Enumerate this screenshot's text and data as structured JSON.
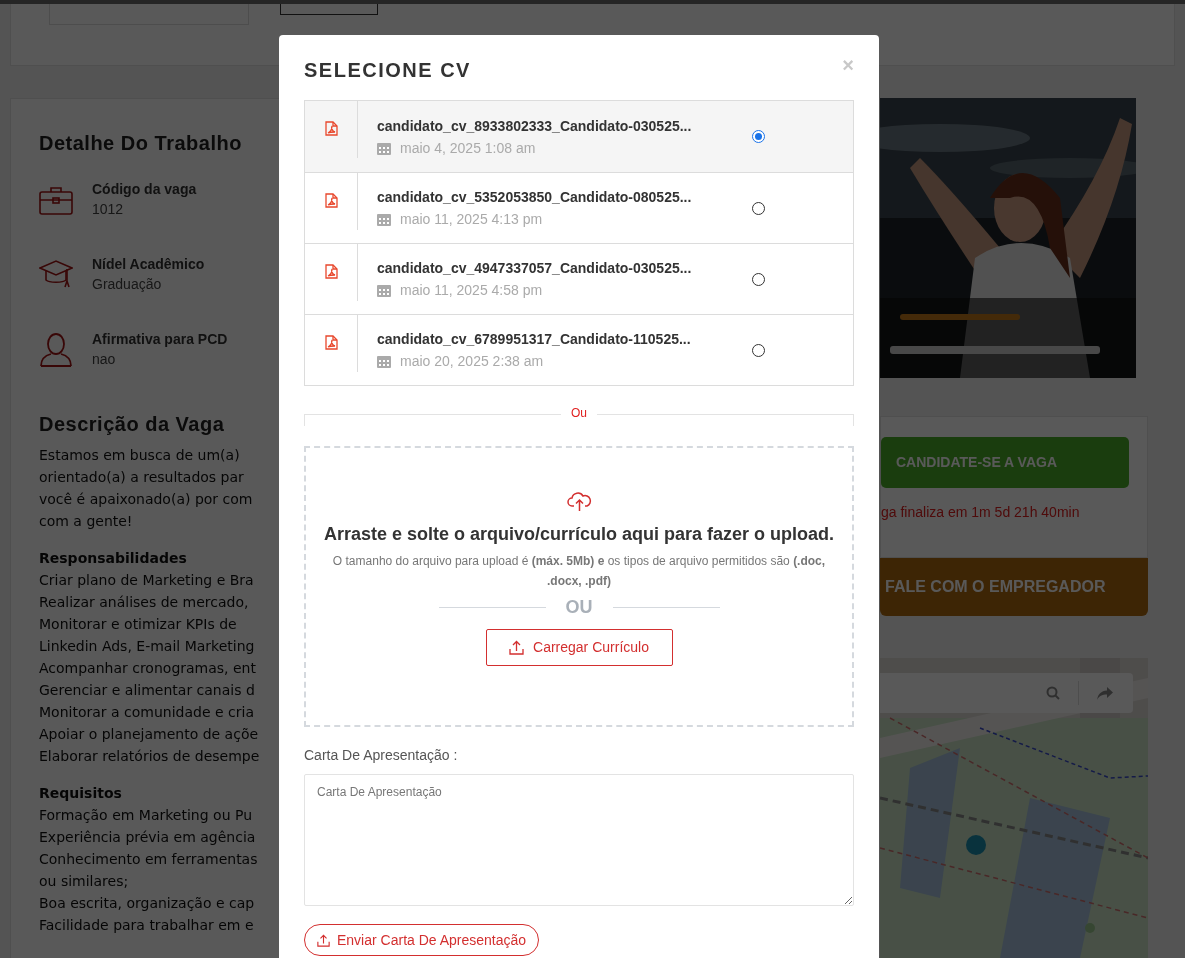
{
  "job_details": {
    "heading": "Detalhe Do Trabalho",
    "items": [
      {
        "kind": "briefcase",
        "label": "Código da vaga",
        "value": "1012"
      },
      {
        "kind": "cap",
        "label": "Nídel Acadêmico",
        "value": "Graduação"
      },
      {
        "kind": "person",
        "label": "Afirmativa para PCD",
        "value": "nao"
      }
    ]
  },
  "description": {
    "heading": "Descrição da Vaga",
    "sections": [
      {
        "lines": [
          "Estamos em busca de um(a)",
          "orientado(a) a resultados par",
          "você é apaixonado(a) por com",
          "com a gente!"
        ]
      },
      {
        "title": "Responsabilidades",
        "lines": [
          "Criar plano de Marketing e Bra",
          "Realizar análises de mercado,",
          "Monitorar e otimizar KPIs de",
          "Linkedin Ads, E-mail Marketing",
          "Acompanhar cronogramas, ent",
          "Gerenciar e alimentar canais d",
          "Monitorar a comunidade e cria",
          "Apoiar o planejamento de açõe",
          "Elaborar relatórios de desempe"
        ]
      },
      {
        "title": "Requisitos",
        "lines": [
          "Formação em Marketing ou Pu",
          "Experiência prévia em agência",
          "Conhecimento em ferramentas",
          "ou similares;",
          "Boa escrita, organização e cap",
          "Facilidade para trabalhar em e"
        ]
      }
    ]
  },
  "sidebar": {
    "apply_button": "CANDIDATE-SE A VAGA",
    "deadline": "ga finaliza em 1m 5d 21h 40min",
    "contact_button": "FALE COM O EMPREGADOR"
  },
  "modal": {
    "title": "SELECIONE CV",
    "close": "×",
    "cvs": [
      {
        "name": "candidato_cv_8933802333_Candidato-030525...",
        "date": "maio 4, 2025 1:08 am",
        "selected": true
      },
      {
        "name": "candidato_cv_5352053850_Candidato-080525...",
        "date": "maio 11, 2025 4:13 pm",
        "selected": false
      },
      {
        "name": "candidato_cv_4947337057_Candidato-030525...",
        "date": "maio 11, 2025 4:58 pm",
        "selected": false
      },
      {
        "name": "candidato_cv_6789951317_Candidato-110525...",
        "date": "maio 20, 2025 2:38 am",
        "selected": false
      }
    ],
    "divider": "Ou",
    "dropzone": {
      "heading": "Arraste e solte o arquivo/currículo aqui para fazer o upload.",
      "info": "O tamanho do arquivo para upload é **(máx. 5Mb) e** os tipos de arquivo permitidos são **(.doc, .docx, .pdf)**",
      "separator": "OU",
      "button": "Carregar Currículo"
    },
    "cover_letter": {
      "label": "Carta De Apresentação :",
      "placeholder": "Carta De Apresentação",
      "button": "Enviar Carta De Apresentação"
    }
  }
}
